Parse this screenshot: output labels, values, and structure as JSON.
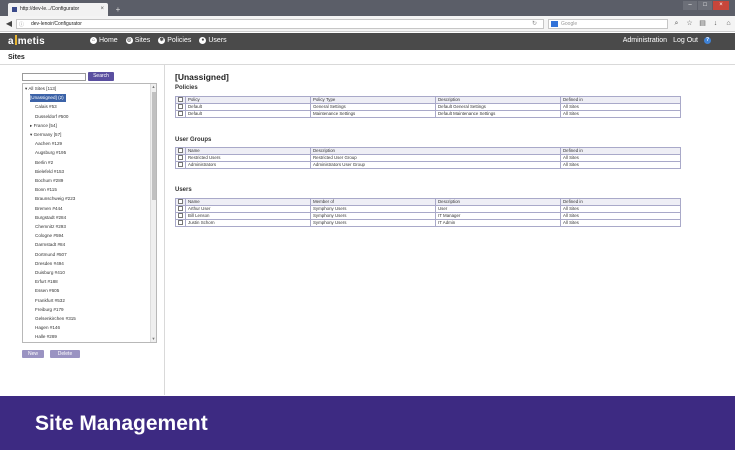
{
  "browser": {
    "tab_title": "http://dev-le.../Configurator",
    "tab_close": "×",
    "new_tab": "+",
    "url": "dev-lenoir/Configurator",
    "search_placeholder": "Google",
    "window_buttons": [
      "–",
      "□",
      "×"
    ]
  },
  "app": {
    "logo": "metis",
    "logo_prefix": "a",
    "nav": [
      {
        "label": "Home",
        "icon": "home-icon"
      },
      {
        "label": "Sites",
        "icon": "sites-icon"
      },
      {
        "label": "Policies",
        "icon": "gear-icon"
      },
      {
        "label": "Users",
        "icon": "user-icon"
      }
    ],
    "right": {
      "admin": "Administration",
      "logout": "Log Out",
      "help": "?"
    }
  },
  "page": {
    "title": "Sites"
  },
  "sidebar": {
    "search_value": "",
    "search_button": "Search",
    "tree": [
      {
        "label": "▾ All Sites [113]",
        "level": 0
      },
      {
        "label": "[Unassigned] (2)",
        "level": 1,
        "selected": true
      },
      {
        "label": "Calais #53",
        "level": 2
      },
      {
        "label": "Dusseldorf #500",
        "level": 2
      },
      {
        "label": "▸ France [54]",
        "level": 1
      },
      {
        "label": "▾ Germany [57]",
        "level": 1
      },
      {
        "label": "Aachen #129",
        "level": 2
      },
      {
        "label": "Augsburg #195",
        "level": 2
      },
      {
        "label": "Berlin #2",
        "level": 2
      },
      {
        "label": "Bielefeld #153",
        "level": 2
      },
      {
        "label": "Bochum #289",
        "level": 2
      },
      {
        "label": "Bonn #115",
        "level": 2
      },
      {
        "label": "Braunschweig #223",
        "level": 2
      },
      {
        "label": "Bremen #444",
        "level": 2
      },
      {
        "label": "Burgstadt #284",
        "level": 2
      },
      {
        "label": "Chemnitz #293",
        "level": 2
      },
      {
        "label": "Cologne #594",
        "level": 2
      },
      {
        "label": "Darmstadt #84",
        "level": 2
      },
      {
        "label": "Dortmund #507",
        "level": 2
      },
      {
        "label": "Dresden #494",
        "level": 2
      },
      {
        "label": "Duisburg #410",
        "level": 2
      },
      {
        "label": "Erfurt #188",
        "level": 2
      },
      {
        "label": "Essen #605",
        "level": 2
      },
      {
        "label": "Frankfurt #532",
        "level": 2
      },
      {
        "label": "Freiburg #179",
        "level": 2
      },
      {
        "label": "Gelsenkirchen #315",
        "level": 2
      },
      {
        "label": "Hagen #146",
        "level": 2
      },
      {
        "label": "Halle #289",
        "level": 2
      }
    ],
    "new_button": "New",
    "delete_button": "Delete"
  },
  "main": {
    "title": "[Unassigned]",
    "policies": {
      "title": "Policies",
      "columns": [
        "Policy",
        "Policy Type",
        "Description",
        "Defined in"
      ],
      "rows": [
        [
          "Default",
          "General Settings",
          "Default General Settings",
          "All Sites"
        ],
        [
          "Default",
          "Maintenance Settings",
          "Default Maintenance Settings",
          "All Sites"
        ]
      ]
    },
    "user_groups": {
      "title": "User Groups",
      "columns": [
        "Name",
        "Description",
        "Defined in"
      ],
      "rows": [
        [
          "Restricted Users",
          "Restricted User Group",
          "All Sites"
        ],
        [
          "Administrators",
          "Administrators User Group",
          "All Sites"
        ]
      ]
    },
    "users": {
      "title": "Users",
      "columns": [
        "Name",
        "Member of",
        "Description",
        "Defined in"
      ],
      "rows": [
        [
          "Arthur User",
          "Symphony Users",
          "User",
          "All Sites"
        ],
        [
          "Bill Lenson",
          "Symphony Users",
          "IT Manager",
          "All Sites"
        ],
        [
          "Justin Schorn",
          "Symphony Users",
          "IT Admin",
          "All Sites"
        ]
      ]
    }
  },
  "caption": "Site Management",
  "colors": {
    "caption_bg": "#3d2a82",
    "appbar_bg": "#4a4a4a",
    "button": "#5a4fa0",
    "selected": "#3c63a8",
    "logo_accent": "#e8b632"
  }
}
